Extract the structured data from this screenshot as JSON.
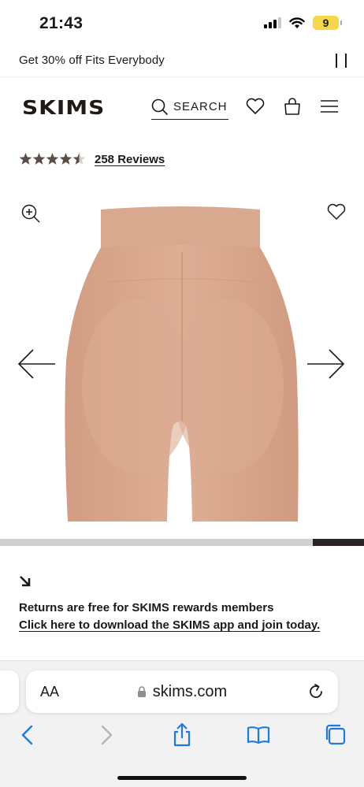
{
  "status_bar": {
    "time": "21:43",
    "battery": "9"
  },
  "promo": {
    "text": "Get 30% off Fits Everybody",
    "pause_icon": "pause-icon"
  },
  "header": {
    "logo": "SKIMS",
    "search_label": "SEARCH"
  },
  "reviews": {
    "rating": 4.5,
    "count_label": "258 Reviews"
  },
  "gallery": {
    "current_position": 0.86
  },
  "returns": {
    "line1": "Returns are free for SKIMS rewards members",
    "line2": "Click here to download the SKIMS app and join today."
  },
  "browser": {
    "aa_label": "AA",
    "domain": "skims.com"
  },
  "colors": {
    "product": "#d9a78c",
    "accent": "#2a2522"
  }
}
